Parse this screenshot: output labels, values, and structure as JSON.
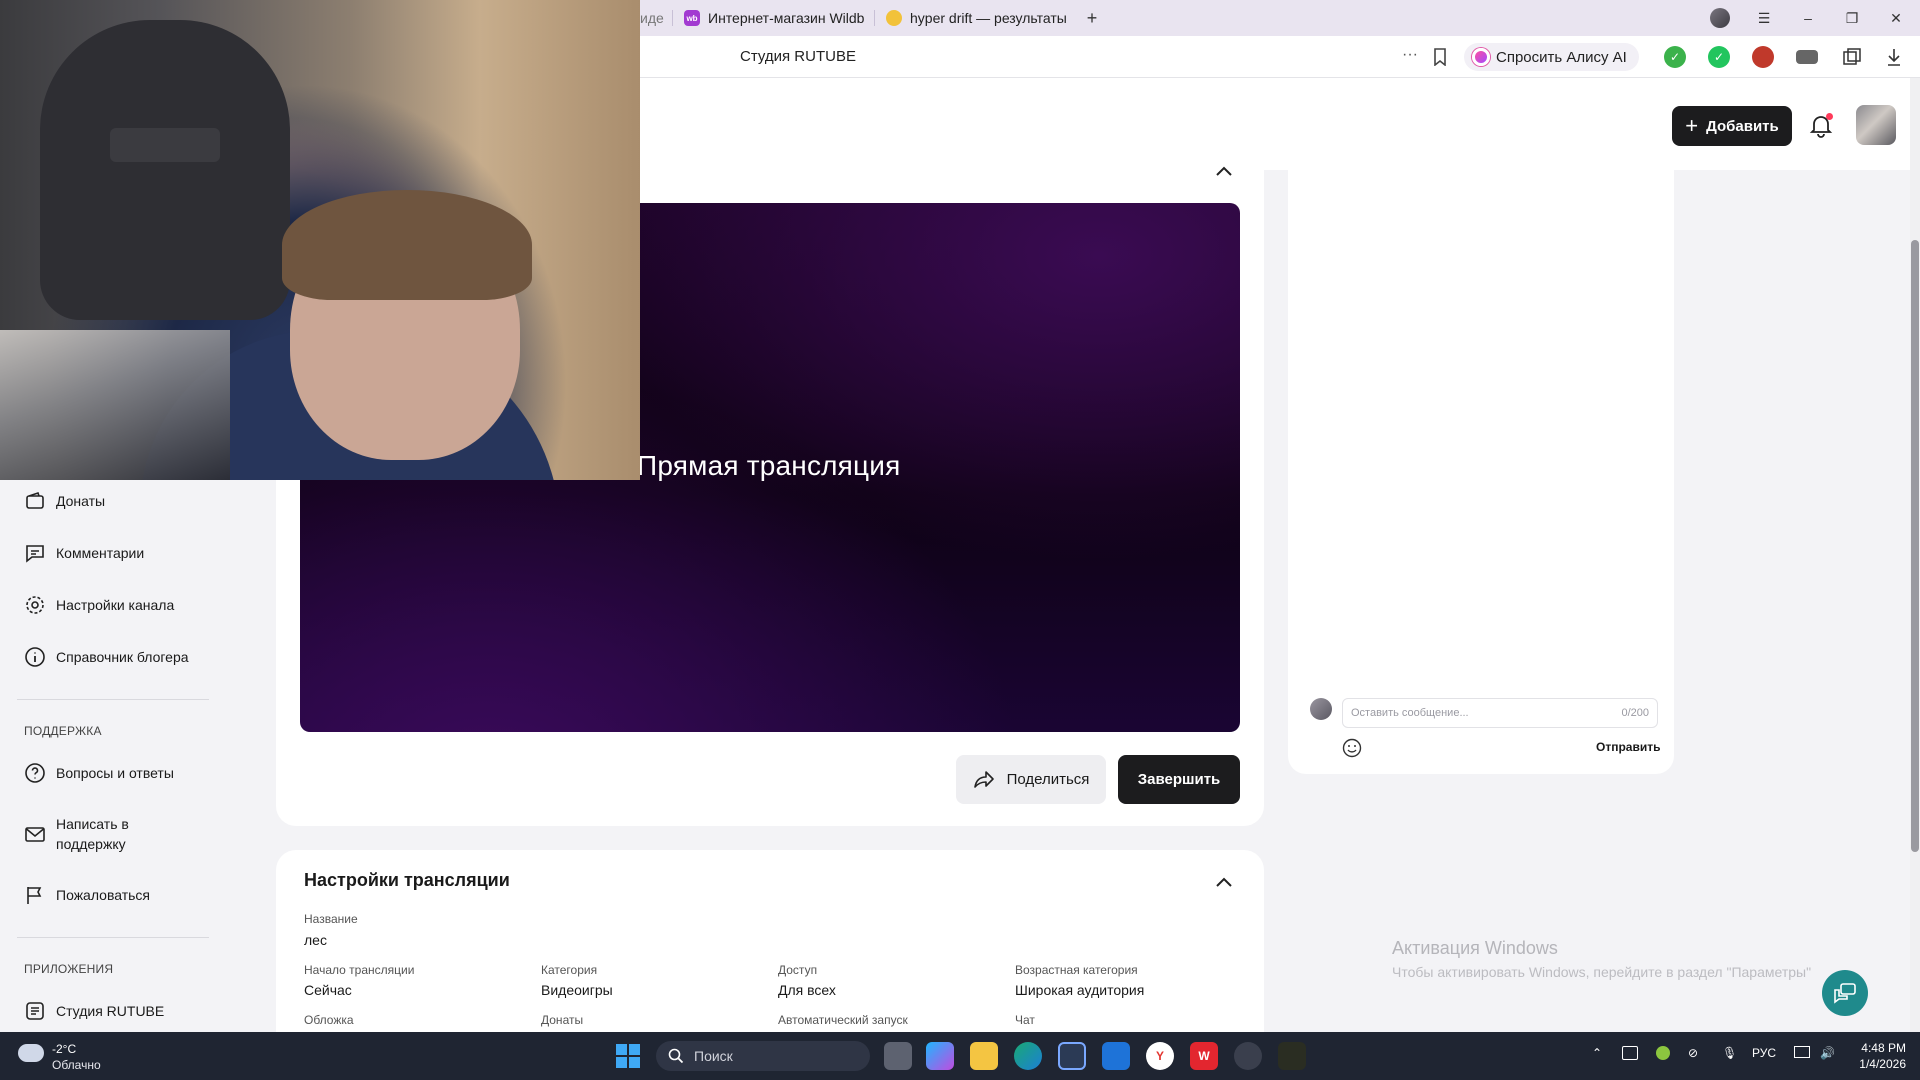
{
  "browser": {
    "tabs": [
      {
        "label": "иде"
      },
      {
        "label": "Интернет-магазин Wildb"
      },
      {
        "label": "hyper drift — результаты"
      }
    ],
    "address_title": "Студия RUTUBE",
    "alice_label": "Спросить Алису AI"
  },
  "header": {
    "add_label": "Добавить"
  },
  "sidebar": {
    "items": [
      {
        "label": "Донаты",
        "icon": "wallet-icon"
      },
      {
        "label": "Комментарии",
        "icon": "comment-icon"
      },
      {
        "label": "Настройки канала",
        "icon": "gear-icon"
      },
      {
        "label": "Справочник блогера",
        "icon": "info-icon"
      }
    ],
    "support_section": "ПОДДЕРЖКА",
    "support_items": [
      {
        "label": "Вопросы и ответы",
        "icon": "question-icon"
      },
      {
        "label": "Написать в поддержку",
        "icon": "mail-icon"
      },
      {
        "label": "Пожаловаться",
        "icon": "flag-icon"
      }
    ],
    "apps_section": "ПРИЛОЖЕНИЯ",
    "apps_items": [
      {
        "label": "Студия RUTUBE",
        "icon": "rutube-icon"
      }
    ]
  },
  "stream": {
    "player_title": "Прямая трансляция",
    "share_label": "Поделиться",
    "end_label": "Завершить"
  },
  "chat": {
    "placeholder": "Оставить сообщение...",
    "counter": "0/200",
    "send_label": "Отправить"
  },
  "settings": {
    "title": "Настройки трансляции",
    "name_label": "Название",
    "name_value": "лес",
    "start_label": "Начало трансляции",
    "start_value": "Сейчас",
    "category_label": "Категория",
    "category_value": "Видеоигры",
    "access_label": "Доступ",
    "access_value": "Для всех",
    "age_label": "Возрастная категория",
    "age_value": "Широкая аудитория",
    "cover_label": "Обложка",
    "donations_label": "Донаты",
    "autostart_label": "Автоматический запуск",
    "chat_label": "Чат"
  },
  "watermark": {
    "title": "Активация Windows",
    "subtitle": "Чтобы активировать Windows, перейдите в раздел \"Параметры\""
  },
  "taskbar": {
    "temperature": "-2°C",
    "weather": "Облачно",
    "search_label": "Поиск",
    "lang": "РУС",
    "time": "4:48 PM",
    "date": "1/4/2026"
  },
  "colors": {
    "primary_button": "#1c1c1e",
    "accent": "#1f8a8c",
    "player_gradient": "#1d0428"
  }
}
